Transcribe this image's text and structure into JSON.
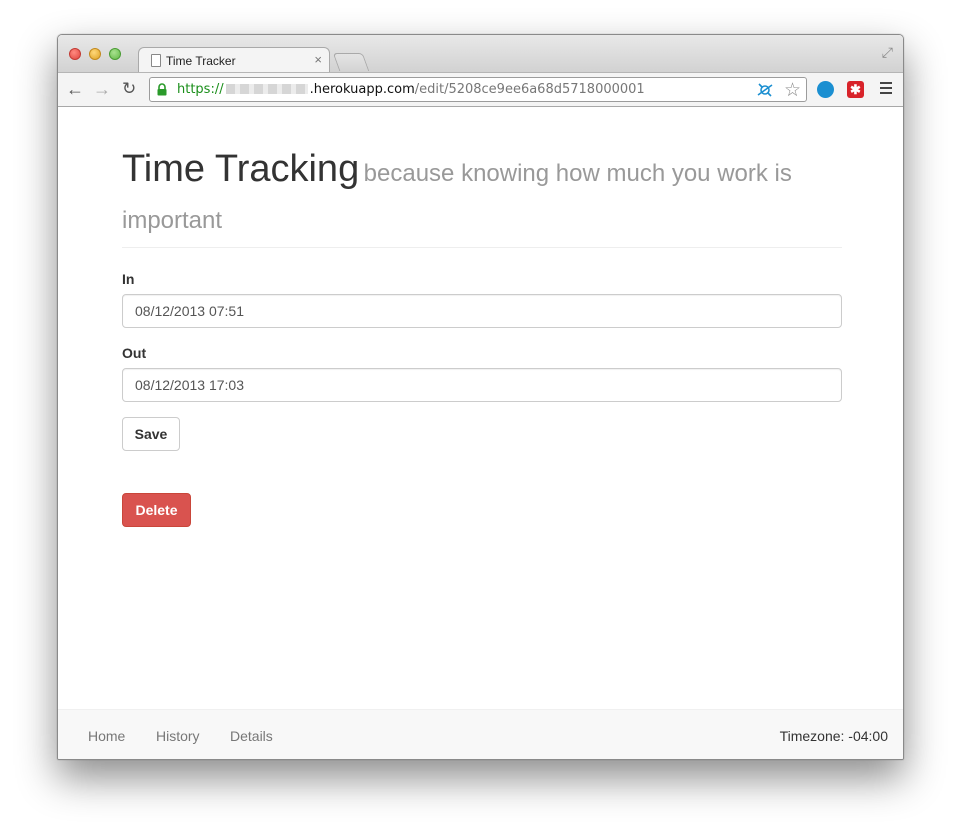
{
  "browser": {
    "tab_title": "Time Tracker",
    "tab_close": "×",
    "url": {
      "scheme": "https://",
      "host": ".herokuapp.com",
      "path": "/edit/5208ce9ee6a68d5718000001"
    },
    "icons": {
      "back": "←",
      "forward": "→",
      "reload": "↻",
      "star": "☆",
      "fullscreen": "⤢",
      "ext2": "✱"
    }
  },
  "header": {
    "title": "Time Tracking",
    "subtitle": "because knowing how much you work is important"
  },
  "form": {
    "in_label": "In",
    "in_value": "08/12/2013 07:51",
    "out_label": "Out",
    "out_value": "08/12/2013 17:03",
    "save_label": "Save",
    "delete_label": "Delete"
  },
  "footer": {
    "links": [
      "Home",
      "History",
      "Details"
    ],
    "timezone": "Timezone: -04:00"
  },
  "colors": {
    "delete_button": "#d9534f",
    "secure_scheme": "#1b8f1b",
    "subtitle": "#999999"
  }
}
